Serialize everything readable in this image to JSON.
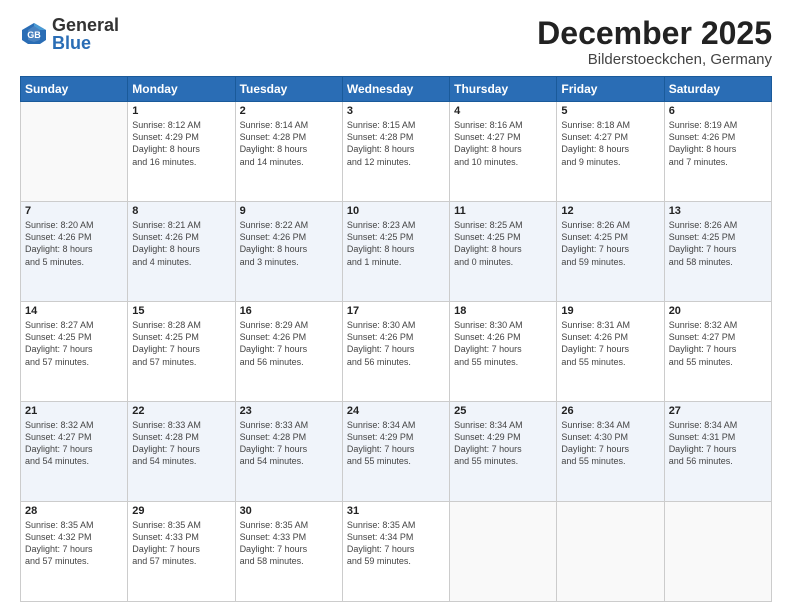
{
  "logo": {
    "general": "General",
    "blue": "Blue"
  },
  "title": "December 2025",
  "location": "Bilderstoeckchen, Germany",
  "days_of_week": [
    "Sunday",
    "Monday",
    "Tuesday",
    "Wednesday",
    "Thursday",
    "Friday",
    "Saturday"
  ],
  "weeks": [
    [
      {
        "num": "",
        "info": ""
      },
      {
        "num": "1",
        "info": "Sunrise: 8:12 AM\nSunset: 4:29 PM\nDaylight: 8 hours\nand 16 minutes."
      },
      {
        "num": "2",
        "info": "Sunrise: 8:14 AM\nSunset: 4:28 PM\nDaylight: 8 hours\nand 14 minutes."
      },
      {
        "num": "3",
        "info": "Sunrise: 8:15 AM\nSunset: 4:28 PM\nDaylight: 8 hours\nand 12 minutes."
      },
      {
        "num": "4",
        "info": "Sunrise: 8:16 AM\nSunset: 4:27 PM\nDaylight: 8 hours\nand 10 minutes."
      },
      {
        "num": "5",
        "info": "Sunrise: 8:18 AM\nSunset: 4:27 PM\nDaylight: 8 hours\nand 9 minutes."
      },
      {
        "num": "6",
        "info": "Sunrise: 8:19 AM\nSunset: 4:26 PM\nDaylight: 8 hours\nand 7 minutes."
      }
    ],
    [
      {
        "num": "7",
        "info": "Sunrise: 8:20 AM\nSunset: 4:26 PM\nDaylight: 8 hours\nand 5 minutes."
      },
      {
        "num": "8",
        "info": "Sunrise: 8:21 AM\nSunset: 4:26 PM\nDaylight: 8 hours\nand 4 minutes."
      },
      {
        "num": "9",
        "info": "Sunrise: 8:22 AM\nSunset: 4:26 PM\nDaylight: 8 hours\nand 3 minutes."
      },
      {
        "num": "10",
        "info": "Sunrise: 8:23 AM\nSunset: 4:25 PM\nDaylight: 8 hours\nand 1 minute."
      },
      {
        "num": "11",
        "info": "Sunrise: 8:25 AM\nSunset: 4:25 PM\nDaylight: 8 hours\nand 0 minutes."
      },
      {
        "num": "12",
        "info": "Sunrise: 8:26 AM\nSunset: 4:25 PM\nDaylight: 7 hours\nand 59 minutes."
      },
      {
        "num": "13",
        "info": "Sunrise: 8:26 AM\nSunset: 4:25 PM\nDaylight: 7 hours\nand 58 minutes."
      }
    ],
    [
      {
        "num": "14",
        "info": "Sunrise: 8:27 AM\nSunset: 4:25 PM\nDaylight: 7 hours\nand 57 minutes."
      },
      {
        "num": "15",
        "info": "Sunrise: 8:28 AM\nSunset: 4:25 PM\nDaylight: 7 hours\nand 57 minutes."
      },
      {
        "num": "16",
        "info": "Sunrise: 8:29 AM\nSunset: 4:26 PM\nDaylight: 7 hours\nand 56 minutes."
      },
      {
        "num": "17",
        "info": "Sunrise: 8:30 AM\nSunset: 4:26 PM\nDaylight: 7 hours\nand 56 minutes."
      },
      {
        "num": "18",
        "info": "Sunrise: 8:30 AM\nSunset: 4:26 PM\nDaylight: 7 hours\nand 55 minutes."
      },
      {
        "num": "19",
        "info": "Sunrise: 8:31 AM\nSunset: 4:26 PM\nDaylight: 7 hours\nand 55 minutes."
      },
      {
        "num": "20",
        "info": "Sunrise: 8:32 AM\nSunset: 4:27 PM\nDaylight: 7 hours\nand 55 minutes."
      }
    ],
    [
      {
        "num": "21",
        "info": "Sunrise: 8:32 AM\nSunset: 4:27 PM\nDaylight: 7 hours\nand 54 minutes."
      },
      {
        "num": "22",
        "info": "Sunrise: 8:33 AM\nSunset: 4:28 PM\nDaylight: 7 hours\nand 54 minutes."
      },
      {
        "num": "23",
        "info": "Sunrise: 8:33 AM\nSunset: 4:28 PM\nDaylight: 7 hours\nand 54 minutes."
      },
      {
        "num": "24",
        "info": "Sunrise: 8:34 AM\nSunset: 4:29 PM\nDaylight: 7 hours\nand 55 minutes."
      },
      {
        "num": "25",
        "info": "Sunrise: 8:34 AM\nSunset: 4:29 PM\nDaylight: 7 hours\nand 55 minutes."
      },
      {
        "num": "26",
        "info": "Sunrise: 8:34 AM\nSunset: 4:30 PM\nDaylight: 7 hours\nand 55 minutes."
      },
      {
        "num": "27",
        "info": "Sunrise: 8:34 AM\nSunset: 4:31 PM\nDaylight: 7 hours\nand 56 minutes."
      }
    ],
    [
      {
        "num": "28",
        "info": "Sunrise: 8:35 AM\nSunset: 4:32 PM\nDaylight: 7 hours\nand 57 minutes."
      },
      {
        "num": "29",
        "info": "Sunrise: 8:35 AM\nSunset: 4:33 PM\nDaylight: 7 hours\nand 57 minutes."
      },
      {
        "num": "30",
        "info": "Sunrise: 8:35 AM\nSunset: 4:33 PM\nDaylight: 7 hours\nand 58 minutes."
      },
      {
        "num": "31",
        "info": "Sunrise: 8:35 AM\nSunset: 4:34 PM\nDaylight: 7 hours\nand 59 minutes."
      },
      {
        "num": "",
        "info": ""
      },
      {
        "num": "",
        "info": ""
      },
      {
        "num": "",
        "info": ""
      }
    ]
  ]
}
